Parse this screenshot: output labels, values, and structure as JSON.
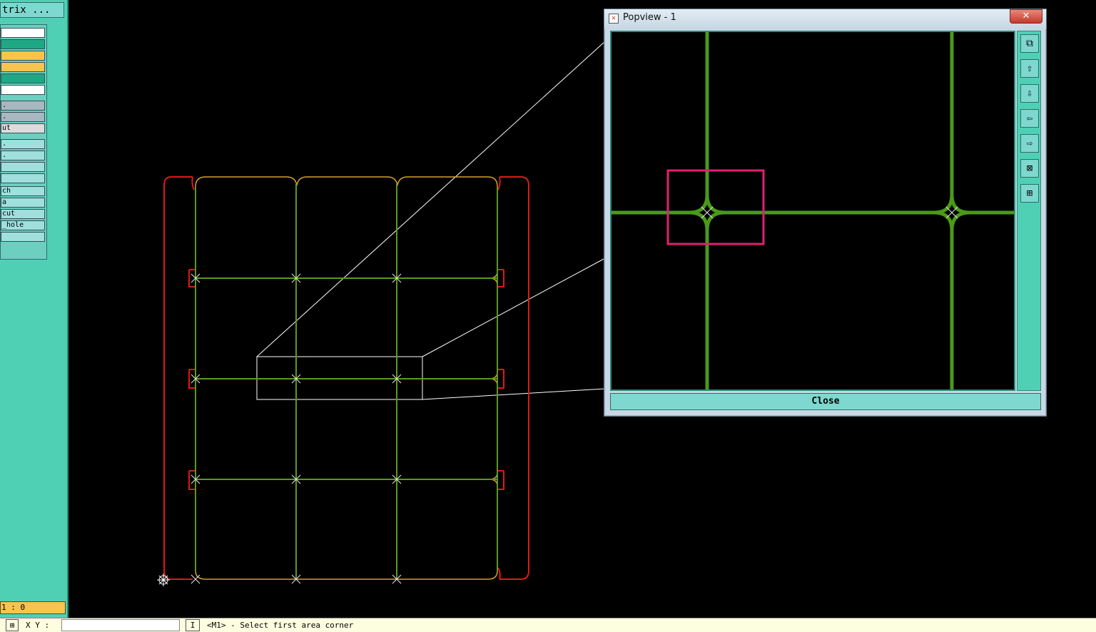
{
  "left_panel": {
    "title": "trix ...",
    "layers": [
      {
        "label": "",
        "color": "#ffffff"
      },
      {
        "label": "",
        "color": "#1fa884"
      },
      {
        "label": "",
        "color": "#f8c44c"
      },
      {
        "label": "",
        "color": "#f8c44c"
      },
      {
        "label": "",
        "color": "#1fa884"
      },
      {
        "label": "",
        "color": "#ffffff"
      },
      {
        "label": ".",
        "color": "#a8b8c0"
      },
      {
        "label": ".",
        "color": "#a8b8c0"
      },
      {
        "label": "ut",
        "color": "#dcdcdc"
      },
      {
        "label": ".",
        "color": "#9fe0dc"
      },
      {
        "label": ".",
        "color": "#9fe0dc"
      },
      {
        "label": "",
        "color": "#9fe0dc"
      },
      {
        "label": "",
        "color": "#9fe0dc"
      },
      {
        "label": "ch",
        "color": "#9fe0dc"
      },
      {
        "label": "a",
        "color": "#9fe0dc"
      },
      {
        "label": "cut",
        "color": "#9fe0dc"
      },
      {
        "label": "_hole",
        "color": "#9fe0dc"
      },
      {
        "label": "",
        "color": "#9fe0dc"
      }
    ],
    "coord": "1 : 0"
  },
  "popview": {
    "title": "Popview - 1",
    "close_x": "✕",
    "close_button": "Close",
    "tools": [
      "zoom-fit-icon",
      "pan-up-icon",
      "pan-down-icon",
      "pan-left-icon",
      "pan-right-icon",
      "zoom-in-icon",
      "zoom-out-icon"
    ],
    "tool_glyphs": [
      "⧉",
      "⇧",
      "⇩",
      "⇦",
      "⇨",
      "⊠",
      "⊞"
    ]
  },
  "statusbar": {
    "icon": "⊞",
    "xy_label": "X Y :",
    "input_value": "",
    "mode": "I",
    "prompt": "<M1> - Select first area corner"
  },
  "colors": {
    "board_outline": "#e01818",
    "trace": "#5a9a20",
    "trace_edge": "#d4a030",
    "zoom_frame": "#ffffff",
    "highlight": "#e02070"
  }
}
